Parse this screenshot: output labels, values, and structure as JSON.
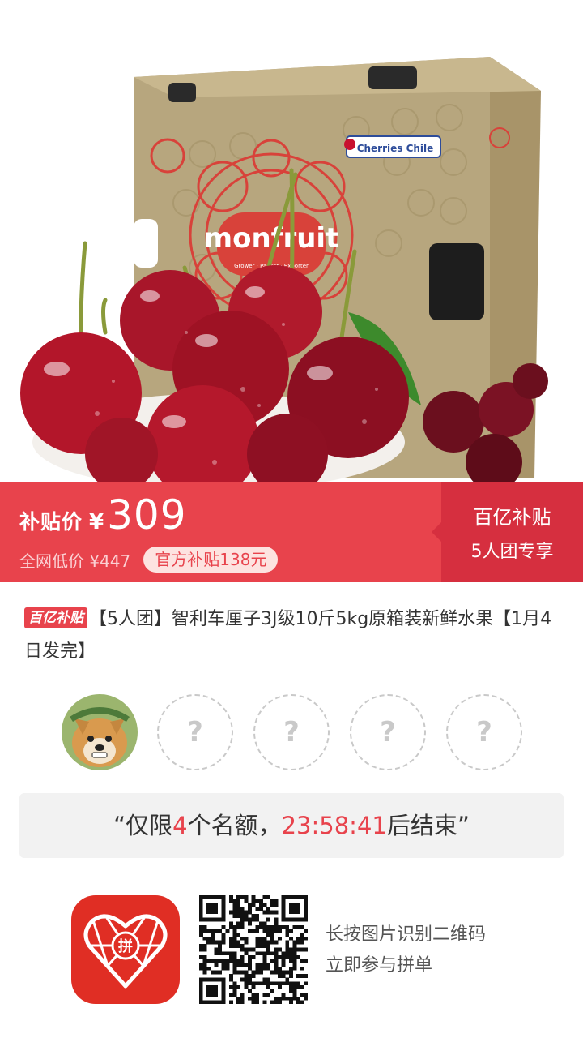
{
  "hero": {
    "brand_text": "monfruit",
    "brand_subtext": "Grower · Packer · Exporter",
    "origin_badge": "Cherries Chile"
  },
  "banner": {
    "price_label": "补贴价",
    "currency": "¥",
    "price": "309",
    "original_price": "全网低价 ¥447",
    "subsidy_tag": "官方补贴138元",
    "right_title": "百亿补贴",
    "right_subtitle": "5人团专享",
    "colors": {
      "primary": "#e8434c",
      "secondary": "#d62f3f"
    }
  },
  "product": {
    "badge": "百亿补贴",
    "title": "【5人团】智利车厘子3J级10斤5kg原箱装新鲜水果【1月4日发完】"
  },
  "group": {
    "members": [
      {
        "type": "avatar",
        "icon": "dog-avatar-icon"
      },
      {
        "type": "empty",
        "symbol": "?"
      },
      {
        "type": "empty",
        "symbol": "?"
      },
      {
        "type": "empty",
        "symbol": "?"
      },
      {
        "type": "empty",
        "symbol": "?"
      }
    ]
  },
  "countdown": {
    "prefix": "“仅限",
    "count": "4",
    "middle": "个名额，",
    "time": "23:58:41",
    "suffix": "后结束”"
  },
  "footer": {
    "logo_icon": "pinduoduo-logo-icon",
    "logo_char": "拼",
    "qr_icon": "qr-code-icon",
    "line1": "长按图片识别二维码",
    "line2": "立即参与拼单"
  }
}
